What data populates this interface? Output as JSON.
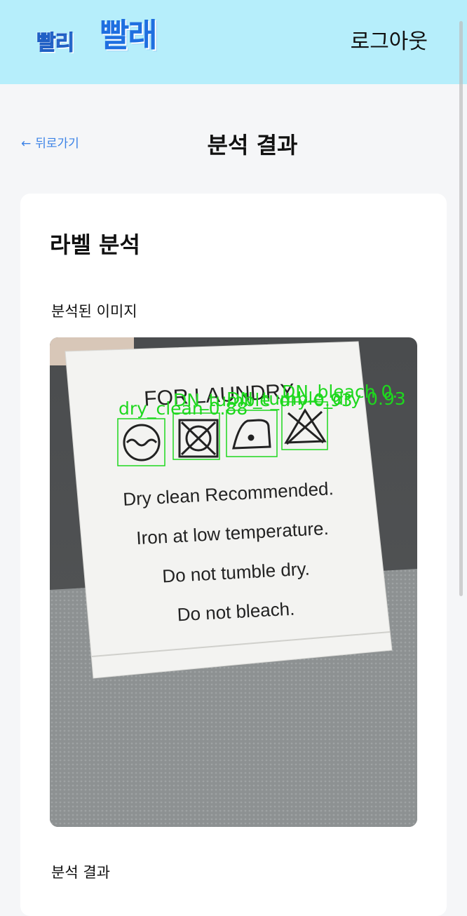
{
  "header": {
    "logo_small": "빨리",
    "logo_big": "빨래",
    "logout_label": "로그아웃"
  },
  "nav": {
    "back_arrow": "←",
    "back_label": "뒤로가기",
    "page_title": "분석 결과"
  },
  "card": {
    "title": "라벨 분석",
    "image_section_label": "분석된 이미지",
    "result_section_label": "분석 결과"
  },
  "image": {
    "label_heading": "FOR LAUNDRY",
    "label_lines": [
      "Dry clean Recommended.",
      "Iron at low temperature.",
      "Do not tumble dry.",
      "Do not bleach."
    ],
    "detections": [
      {
        "text": "dry_clean 0.88",
        "icon": "dry-clean-icon"
      },
      {
        "text": "DN_tumble_dry 0.93",
        "icon": "no-tumble-dry-icon"
      },
      {
        "text": "DN_tumble_dry 0.93",
        "icon": "iron-low-icon"
      },
      {
        "text": "DN_bleach 0.",
        "icon": "no-bleach-icon"
      }
    ],
    "detection_color": "#1ed81e"
  }
}
